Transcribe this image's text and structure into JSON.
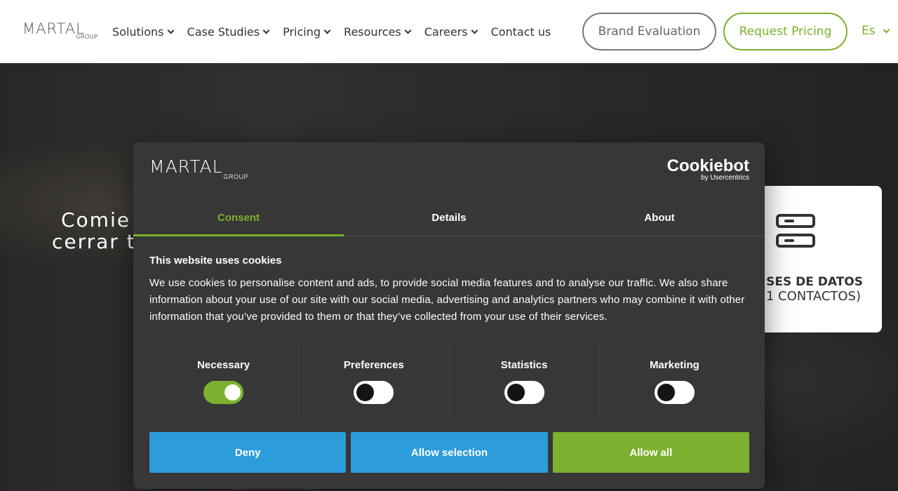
{
  "header": {
    "logo": {
      "word": "MARTAL",
      "sub": "GROUP"
    },
    "nav": [
      {
        "label": "Solutions",
        "has_menu": true
      },
      {
        "label": "Case Studies",
        "has_menu": true
      },
      {
        "label": "Pricing",
        "has_menu": true
      },
      {
        "label": "Resources",
        "has_menu": true
      },
      {
        "label": "Careers",
        "has_menu": true
      },
      {
        "label": "Contact us",
        "has_menu": false
      }
    ],
    "brand_evaluation": "Brand Evaluation",
    "request_pricing": "Request Pricing",
    "language": "Es"
  },
  "hero": {
    "title_line1": "Comie",
    "title_line2": "cerrar t",
    "card": {
      "line1": "SES DE DATOS",
      "line2": "1 CONTACTOS)",
      "icon": "database-icon"
    }
  },
  "cookie": {
    "logo": {
      "word": "MARTAL",
      "sub": "GROUP"
    },
    "provider": {
      "brand": "Cookiebot",
      "by": "by Usercentrics"
    },
    "tabs": [
      "Consent",
      "Details",
      "About"
    ],
    "active_tab": "Consent",
    "heading": "This website uses cookies",
    "body": "We use cookies to personalise content and ads, to provide social media features and to analyse our traffic. We also share information about your use of our site with our social media, advertising and analytics partners who may combine it with other information that you’ve provided to them or that they’ve collected from your use of their services.",
    "categories": [
      {
        "label": "Necessary",
        "enabled": true
      },
      {
        "label": "Preferences",
        "enabled": false
      },
      {
        "label": "Statistics",
        "enabled": false
      },
      {
        "label": "Marketing",
        "enabled": false
      }
    ],
    "buttons": {
      "deny": "Deny",
      "allow_selection": "Allow selection",
      "allow_all": "Allow all"
    }
  },
  "colors": {
    "accent_green": "#7cb02e",
    "button_blue": "#2d9cdb",
    "dialog_bg": "#373737"
  }
}
